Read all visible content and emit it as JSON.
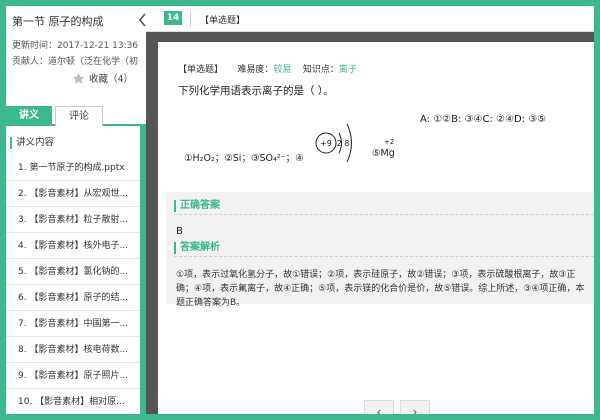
{
  "sidebar": {
    "title": "第一节 原子的构成",
    "updated": "更新时间：2017-12-21 13:36",
    "contributor": "贡献人：道尔顿（泛在化学（初",
    "favorite": "收藏（4）",
    "tabs": {
      "lecture": "讲义",
      "comment": "评论"
    },
    "outline_title": "讲义内容",
    "items": [
      "1. 第一节原子的构成.pptx",
      "2. 【影音素材】从宏观世...",
      "3. 【影音素材】粒子散射...",
      "4. 【影音素材】核外电子...",
      "5. 【影音素材】氯化钠的...",
      "6. 【影音素材】原子的结...",
      "7. 【影音素材】中国第一...",
      "8. 【影音素材】核电荷数...",
      "9. 【影音素材】原子照片...",
      "10. 【影音素材】相对原..."
    ]
  },
  "topbar": {
    "number": "14",
    "type": "【单选题】"
  },
  "question": {
    "type": "【单选题】",
    "difficulty_label": "难易度：",
    "difficulty_value": "较易",
    "knowledge_label": "知识点：",
    "knowledge_value": "离子",
    "stem": "下列化学用语表示离子的是（   ）。",
    "formula": "①H₂O₂；②Si；③SO₄²⁻；④",
    "atom_nucleus": "+9",
    "atom_shells": "2 8",
    "mg": "⑤Mg",
    "mg_sup": "+2",
    "options": "A: ①②B: ③④C: ②④D: ③⑤"
  },
  "answer": {
    "correct_title": "正确答案",
    "correct_value": "B",
    "analysis_title": "答案解析",
    "analysis_text": "①项，表示过氧化氢分子，故①错误；②项，表示硅原子，故②错误；③项，表示硫酸根离子，故③正确；④项，表示氟离子，故④正确；⑤项，表示镁的化合价是价，故⑤错误。综上所述，③④项正确，本题正确答案为B。"
  },
  "nav": {
    "prev": "‹",
    "next": "›"
  },
  "colors": {
    "accent": "#3db88d",
    "dark": "#555555"
  }
}
